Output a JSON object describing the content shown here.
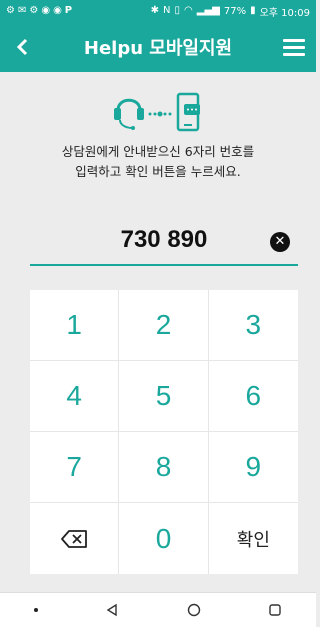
{
  "status_bar": {
    "battery": "77%",
    "time": "오후 10:09"
  },
  "app_bar": {
    "title": "Helpu 모바일지원"
  },
  "instruction": {
    "line1": "상담원에게 안내받으신 6자리 번호를",
    "line2": "입력하고 확인 버튼을 누르세요."
  },
  "code_input": {
    "value": "730 890"
  },
  "keypad": {
    "keys": [
      "1",
      "2",
      "3",
      "4",
      "5",
      "6",
      "7",
      "8",
      "9",
      "",
      "0",
      "확인"
    ]
  },
  "colors": {
    "accent": "#1ba89c",
    "background": "#ececec",
    "text": "#222222"
  },
  "icons": {
    "back": "chevron-left-icon",
    "menu": "hamburger-icon",
    "headset": "headset-icon",
    "phone": "phone-chat-icon",
    "clear": "clear-circle-icon",
    "backspace": "backspace-icon"
  }
}
